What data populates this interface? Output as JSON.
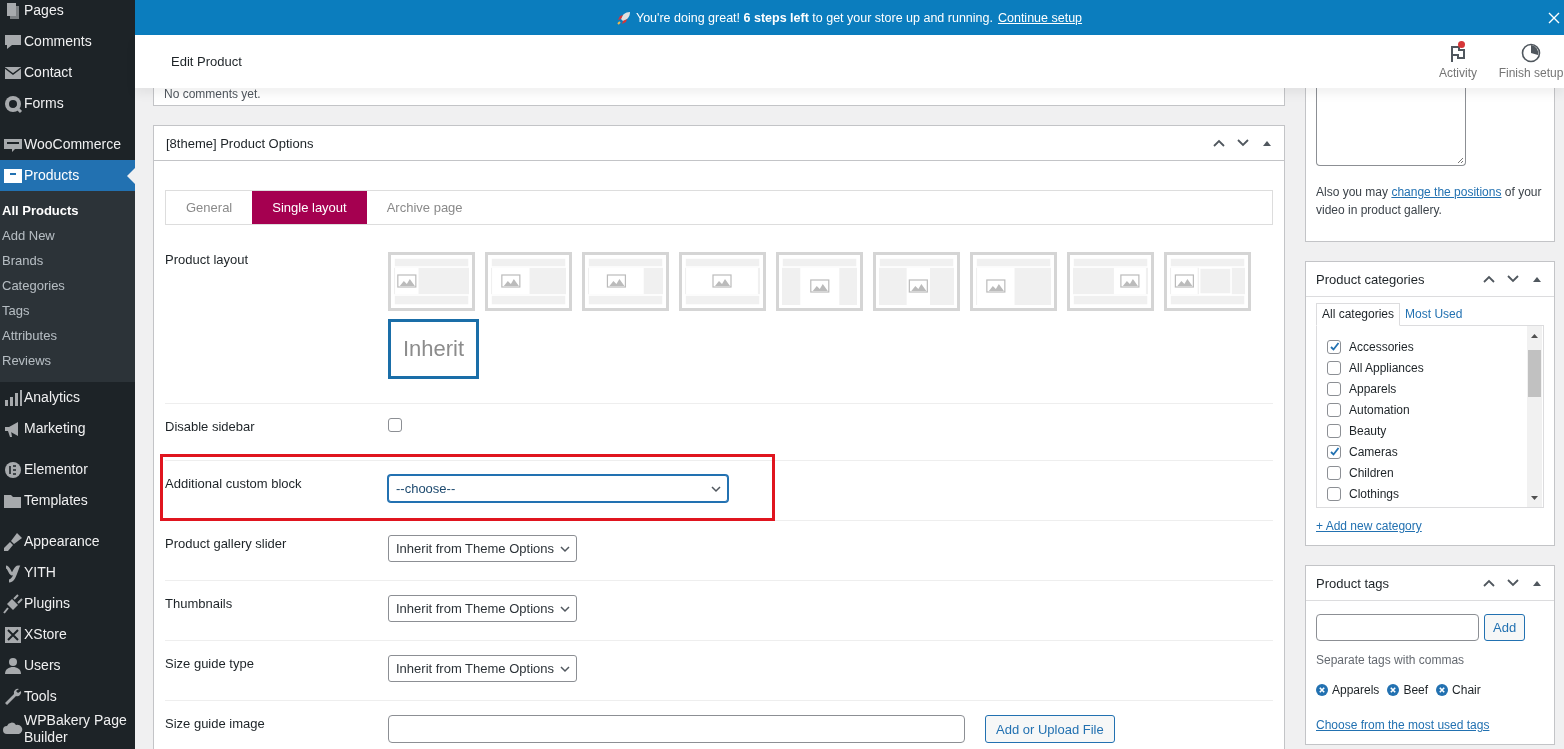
{
  "notice": {
    "text": "You're doing great! **6 steps left** to get your store up and running.",
    "link": "Continue setup"
  },
  "sidebar": {
    "groups": [
      [
        {
          "label": "Pages",
          "selected": false
        },
        {
          "label": "Comments",
          "selected": false
        },
        {
          "label": "Contact",
          "selected": false
        },
        {
          "label": "Forms",
          "selected": false
        }
      ],
      [
        {
          "label": "WooCommerce",
          "selected": false
        },
        {
          "label": "Products",
          "selected": true,
          "children": [
            {
              "label": "All Products",
              "selected": true
            },
            {
              "label": "Add New",
              "selected": false
            },
            {
              "label": "Brands",
              "selected": false
            },
            {
              "label": "Categories",
              "selected": false
            },
            {
              "label": "Tags",
              "selected": false
            },
            {
              "label": "Attributes",
              "selected": false
            },
            {
              "label": "Reviews",
              "selected": false
            }
          ]
        },
        {
          "label": "Analytics",
          "selected": false
        },
        {
          "label": "Marketing",
          "selected": false
        }
      ],
      [
        {
          "label": "Elementor",
          "selected": false
        },
        {
          "label": "Templates",
          "selected": false
        }
      ],
      [
        {
          "label": "Appearance",
          "selected": false
        },
        {
          "label": "YITH",
          "selected": false
        },
        {
          "label": "Plugins",
          "selected": false
        },
        {
          "label": "XStore",
          "selected": false
        },
        {
          "label": "Users",
          "selected": false
        },
        {
          "label": "Tools",
          "selected": false
        },
        {
          "label": "WPBakery Page Builder",
          "selected": false
        }
      ]
    ]
  },
  "header": {
    "title": "Edit Product",
    "actions": [
      {
        "label": "Activity",
        "unread": true
      },
      {
        "label": "Finish setup",
        "unread": false
      }
    ]
  },
  "comments_box": {
    "text": "No comments yet."
  },
  "product_options": {
    "title": "[8theme] Product Options",
    "tabs": [
      {
        "label": "General",
        "selected": false
      },
      {
        "label": "Single layout",
        "selected": true
      },
      {
        "label": "Archive page",
        "selected": false
      }
    ],
    "rows": [
      {
        "kind": "layout",
        "label": "Product layout",
        "options": [
          {
            "kind": "thumbnail",
            "selected": false
          },
          {
            "kind": "thumbnail",
            "selected": false
          },
          {
            "kind": "thumbnail",
            "selected": false
          },
          {
            "kind": "thumbnail",
            "selected": false
          },
          {
            "kind": "thumbnail",
            "selected": false
          },
          {
            "kind": "thumbnail",
            "selected": false
          },
          {
            "kind": "thumbnail",
            "selected": false
          },
          {
            "kind": "thumbnail",
            "selected": false
          },
          {
            "kind": "thumbnail",
            "selected": false
          },
          {
            "kind": "text",
            "label": "Inherit",
            "selected": true
          }
        ]
      },
      {
        "kind": "checkbox",
        "label": "Disable sidebar",
        "checked": false
      },
      {
        "kind": "block_select",
        "label": "Additional custom block",
        "value": "--choose--",
        "focused": true,
        "highlighted": true
      },
      {
        "kind": "select",
        "label": "Product gallery slider",
        "value": "Inherit from Theme Options",
        "focused": false,
        "highlighted": false
      },
      {
        "kind": "select",
        "label": "Thumbnails",
        "value": "Inherit from Theme Options",
        "focused": false,
        "highlighted": false
      },
      {
        "kind": "select",
        "label": "Size guide type",
        "value": "Inherit from Theme Options",
        "focused": false,
        "highlighted": false
      },
      {
        "kind": "file",
        "label": "Size guide image",
        "button": "Add or Upload File"
      }
    ]
  },
  "video_box": {
    "text_before": "Also you may",
    "link": "change the positions",
    "text_after": "of your video in product gallery."
  },
  "categories": {
    "title": "Product categories",
    "tabs": [
      {
        "label": "All categories",
        "selected": true
      },
      {
        "label": "Most Used",
        "selected": false
      }
    ],
    "items": [
      {
        "label": "Accessories",
        "checked": true
      },
      {
        "label": "All Appliances",
        "checked": false
      },
      {
        "label": "Apparels",
        "checked": false
      },
      {
        "label": "Automation",
        "checked": false
      },
      {
        "label": "Beauty",
        "checked": false
      },
      {
        "label": "Cameras",
        "checked": true
      },
      {
        "label": "Children",
        "checked": false
      },
      {
        "label": "Clothings",
        "checked": false
      }
    ],
    "add_link": "+ Add new category"
  },
  "tags": {
    "title": "Product tags",
    "button": "Add",
    "hint": "Separate tags with commas",
    "items": [
      "Apparels",
      "Beef",
      "Chair"
    ],
    "most_used_link": "Choose from the most used tags"
  }
}
